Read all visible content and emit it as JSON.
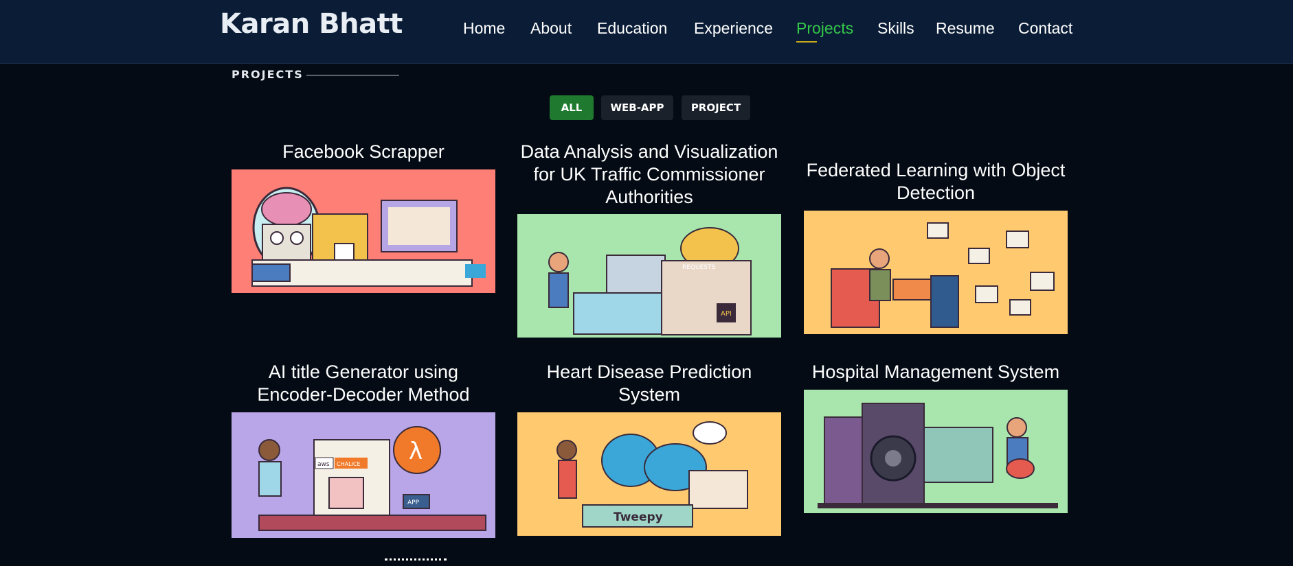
{
  "brand": "Karan Bhatt",
  "nav": [
    "Home",
    "About",
    "Education",
    "Experience",
    "Projects",
    "Skills",
    "Resume",
    "Contact"
  ],
  "nav_active": "Projects",
  "section": {
    "label": "PROJECTS"
  },
  "filters": [
    "ALL",
    "WEB-APP",
    "PROJECT"
  ],
  "filter_active": "ALL",
  "projects": [
    {
      "title": "Facebook Scrapper",
      "bg": "#fe7f76",
      "accent": "#f2c24c"
    },
    {
      "title": "Data Analysis and Visualization for UK Traffic Commissioner Authorities",
      "bg": "#a8e6ad",
      "accent": "#f2c24c",
      "labels": [
        "REQUESTS",
        "API"
      ]
    },
    {
      "title": "Federated Learning with Object Detection",
      "bg": "#ffc96f",
      "accent": "#e65b4f"
    },
    {
      "title": "AI title Generator using Encoder-Decoder Method",
      "bg": "#b9a6e8",
      "accent": "#f07a2a",
      "labels": [
        "aws",
        "CHALICE",
        "λ",
        "APP"
      ]
    },
    {
      "title": "Heart Disease Prediction System",
      "bg": "#ffc96f",
      "accent": "#3aa7d8",
      "labels": [
        "Tweepy"
      ]
    },
    {
      "title": "Hospital Management System",
      "bg": "#a8e6ad",
      "accent": "#7b5b8f"
    }
  ],
  "colors": {
    "navbar": "#0b1d36",
    "page": "#040b14",
    "active": "#34c84a",
    "filter_active": "#1f7a2f"
  }
}
